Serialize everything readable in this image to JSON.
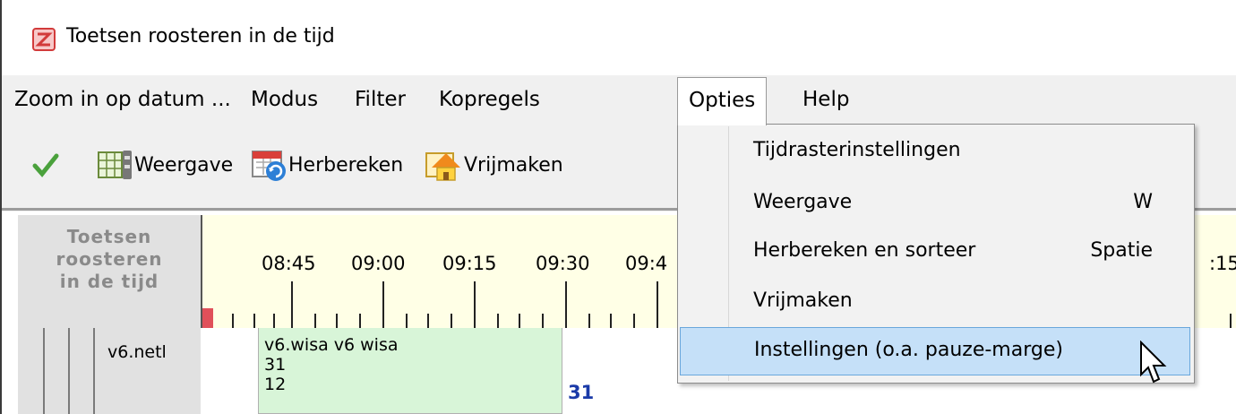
{
  "window": {
    "title": "Toetsen roosteren in de tijd",
    "icon": "app-icon"
  },
  "menubar": {
    "items": [
      {
        "label": "Zoom in op datum ..."
      },
      {
        "label": "Modus"
      },
      {
        "label": "Filter"
      },
      {
        "label": "Kopregels"
      },
      {
        "label": "Opties",
        "state": "open"
      },
      {
        "label": "Help"
      }
    ]
  },
  "toolbar": {
    "apply_icon": "checkmark-icon",
    "buttons": [
      {
        "label": "Weergave",
        "icon": "grid-settings-icon"
      },
      {
        "label": "Herbereken",
        "icon": "calendar-refresh-icon"
      },
      {
        "label": "Vrijmaken",
        "icon": "house-icon"
      }
    ]
  },
  "timeline": {
    "corner_lines": [
      "Toetsen",
      "roosteren",
      "in de tijd"
    ],
    "times": [
      "08:45",
      "09:00",
      "09:15",
      "09:30",
      "09:4",
      ":15"
    ],
    "marker_color": "#e0505a",
    "header_bg": "#ffffe6"
  },
  "rows": [
    {
      "name": "v6.netl",
      "block": {
        "lines": [
          "v6.wisa v6 wisa",
          "31",
          "12"
        ],
        "color": "#d8f5d8"
      },
      "count": "31"
    }
  ],
  "dropdown": {
    "menu": "Opties",
    "items": [
      {
        "label": "Tijdrasterinstellingen",
        "shortcut": ""
      },
      {
        "label": "Weergave",
        "shortcut": "W"
      },
      {
        "label": "Herbereken en sorteer",
        "shortcut": "Spatie"
      },
      {
        "label": "Vrijmaken",
        "shortcut": ""
      },
      {
        "label": "Instellingen (o.a. pauze-marge)",
        "shortcut": "",
        "highlighted": true
      }
    ],
    "highlight_color": "#c5e0f8"
  }
}
